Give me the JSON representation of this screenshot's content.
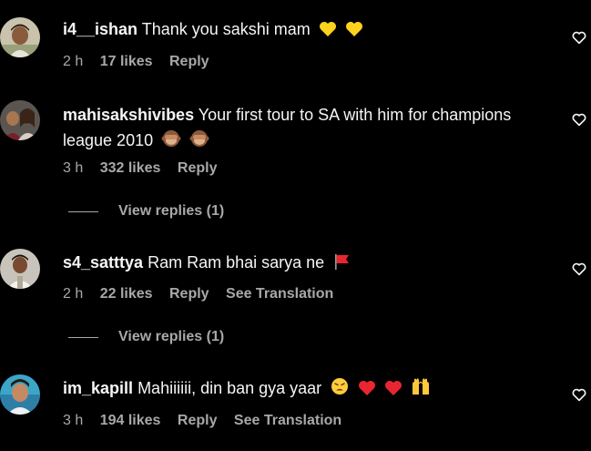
{
  "colors": {
    "background": "#000000",
    "text_primary": "#f5f5f5",
    "text_secondary": "#a8a8a8"
  },
  "comments": [
    {
      "username": "i4__ishan",
      "text": "Thank you sakshi mam",
      "emoji": [
        "yellow-heart",
        "yellow-heart"
      ],
      "time": "2 h",
      "likes": "17 likes",
      "reply": "Reply"
    },
    {
      "username": "mahisakshivibes",
      "text": "Your first tour to SA with him for champions league 2010",
      "emoji": [
        "see-no-evil-monkey",
        "see-no-evil-monkey"
      ],
      "time": "3 h",
      "likes": "332 likes",
      "reply": "Reply",
      "view_replies": "View replies (1)"
    },
    {
      "username": "s4_satttya",
      "text": "Ram Ram bhai sarya ne",
      "emoji": [
        "red-flag"
      ],
      "time": "2 h",
      "likes": "22 likes",
      "reply": "Reply",
      "translation": "See Translation",
      "view_replies": "View replies (1)"
    },
    {
      "username": "im_kapill",
      "text": "Mahiiiiii, din ban gya yaar",
      "emoji": [
        "weary-face",
        "red-heart",
        "red-heart",
        "raising-hands"
      ],
      "time": "3 h",
      "likes": "194 likes",
      "reply": "Reply",
      "translation": "See Translation"
    }
  ]
}
